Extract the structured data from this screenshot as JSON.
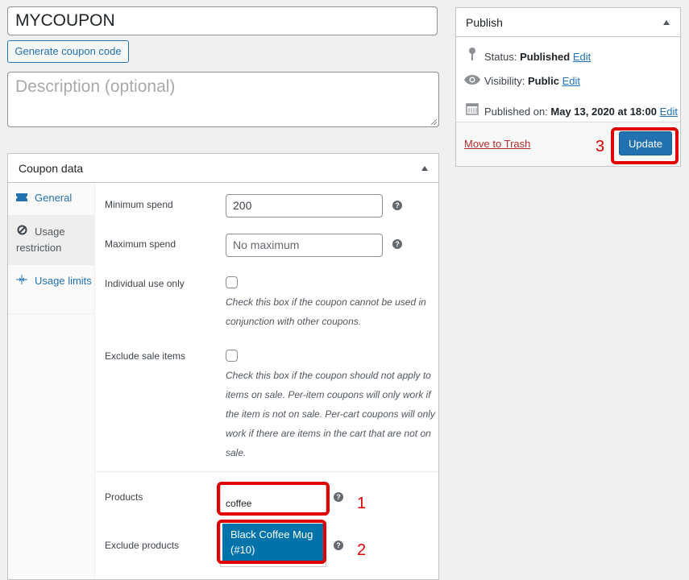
{
  "coupon": {
    "title": "MYCOUPON",
    "generate_label": "Generate coupon code",
    "description_placeholder": "Description (optional)"
  },
  "coupon_data": {
    "heading": "Coupon data",
    "tabs": [
      {
        "label": "General",
        "icon": "ticket-icon"
      },
      {
        "label": "Usage restriction",
        "icon": "prohibited-icon"
      },
      {
        "label": "Usage limits",
        "icon": "arrows-in-icon"
      }
    ],
    "fields": {
      "minimum_spend": {
        "label": "Minimum spend",
        "value": "200"
      },
      "maximum_spend": {
        "label": "Maximum spend",
        "placeholder": "No maximum"
      },
      "individual_use": {
        "label": "Individual use only",
        "checked": false,
        "description": "Check this box if the coupon cannot be used in conjunction with other coupons."
      },
      "exclude_sale": {
        "label": "Exclude sale items",
        "checked": false,
        "description": "Check this box if the coupon should not apply to items on sale. Per-item coupons will only work if the item is not on sale. Per-cart coupons will only work if there are items in the cart that are not on sale."
      },
      "products": {
        "label": "Products",
        "value": "coffee"
      },
      "exclude_products": {
        "label": "Exclude products",
        "suggestion": "Black Coffee Mug (#10)"
      }
    }
  },
  "publish": {
    "heading": "Publish",
    "status_label": "Status:",
    "status_value": "Published",
    "visibility_label": "Visibility:",
    "visibility_value": "Public",
    "published_label": "Published on:",
    "published_value": "May 13, 2020 at 18:00",
    "edit_label": "Edit",
    "trash_label": "Move to Trash",
    "update_label": "Update"
  },
  "annotations": [
    "1",
    "2",
    "3"
  ],
  "colors": {
    "accent": "#2271b1",
    "highlight": "#e10000",
    "suggestion_bg": "#0073aa"
  }
}
